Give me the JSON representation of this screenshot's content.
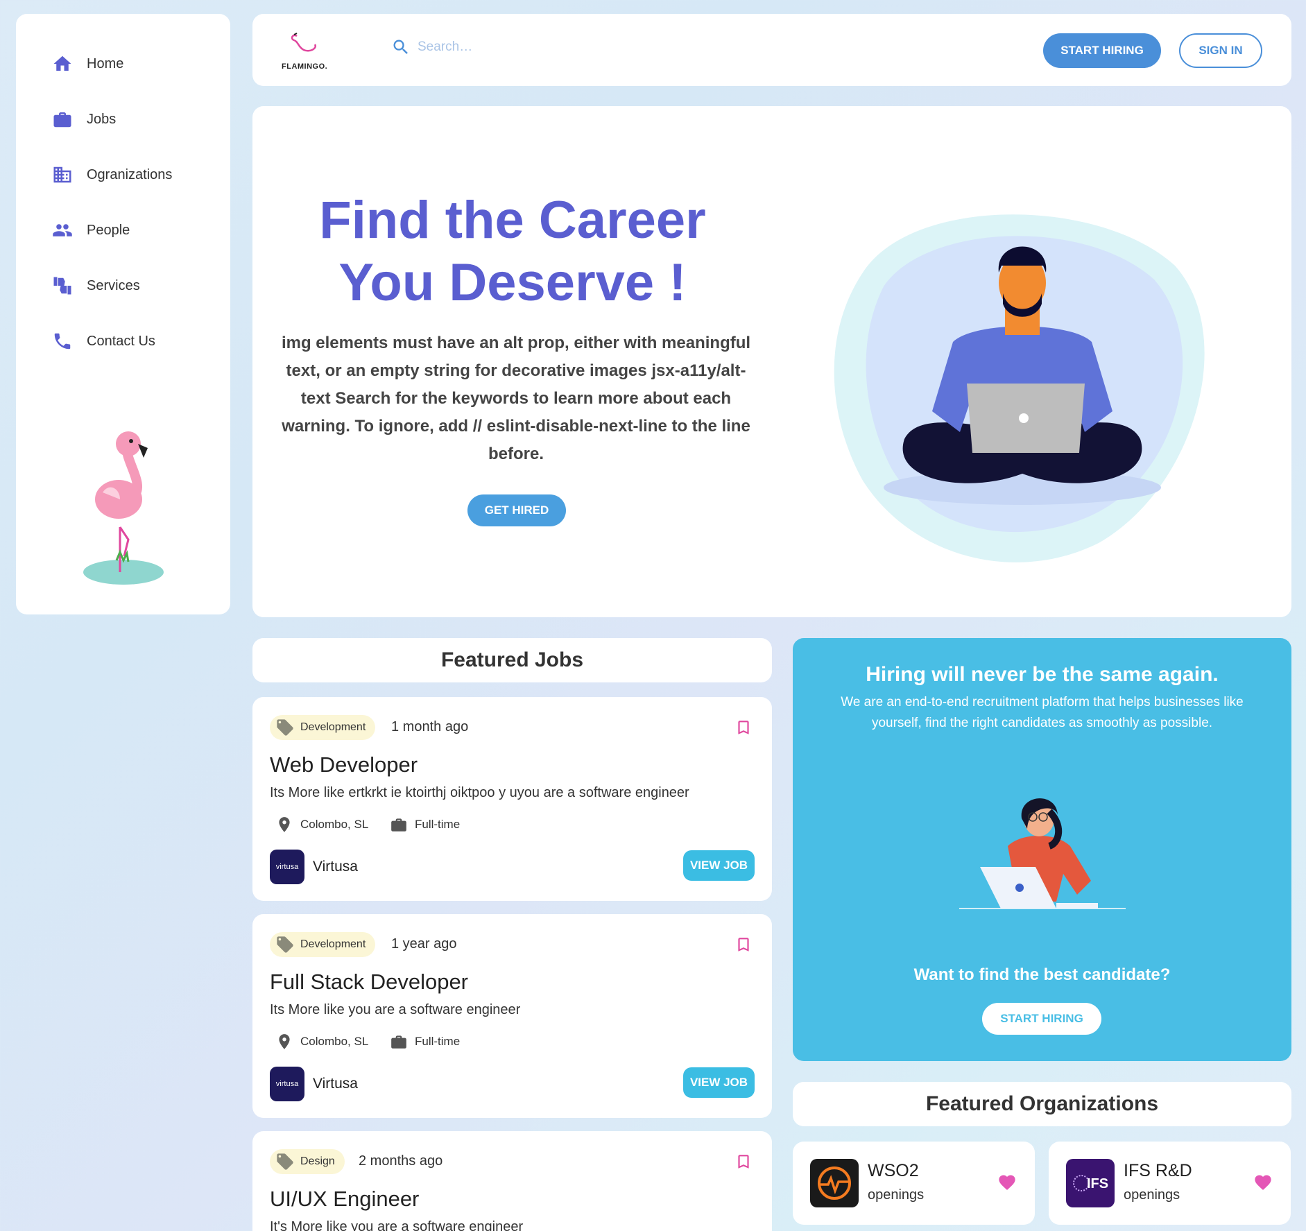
{
  "sidebar": {
    "items": [
      {
        "label": "Home",
        "icon": "home-icon"
      },
      {
        "label": "Jobs",
        "icon": "briefcase-icon"
      },
      {
        "label": "Ogranizations",
        "icon": "building-icon"
      },
      {
        "label": "People",
        "icon": "people-icon"
      },
      {
        "label": "Services",
        "icon": "thumbs-icon"
      },
      {
        "label": "Contact Us",
        "icon": "phone-icon"
      }
    ]
  },
  "header": {
    "logo_text": "FLAMINGO.",
    "search_placeholder": "Search…",
    "start_hiring": "START HIRING",
    "sign_in": "SIGN IN"
  },
  "hero": {
    "title": "Find the Career You Deserve !",
    "text": "img elements must have an alt prop, either with meaningful text, or an empty string for decorative images jsx-a11y/alt-text Search for the keywords to learn more about each warning. To ignore, add // eslint-disable-next-line to the line before.",
    "button": "GET HIRED"
  },
  "featured_jobs": {
    "heading": "Featured Jobs",
    "jobs": [
      {
        "tag": "Development",
        "time": "1 month ago",
        "title": "Web Developer",
        "desc": "Its More like ertkrkt ie ktoirthj oiktpoo y uyou are a software engineer",
        "location": "Colombo, SL",
        "type": "Full-time",
        "company": "Virtusa",
        "company_logo_text": "virtusa",
        "button": "VIEW JOB"
      },
      {
        "tag": "Development",
        "time": "1 year ago",
        "title": "Full Stack Developer",
        "desc": "Its More like you are a software engineer",
        "location": "Colombo, SL",
        "type": "Full-time",
        "company": "Virtusa",
        "company_logo_text": "virtusa",
        "button": "VIEW JOB"
      },
      {
        "tag": "Design",
        "time": "2 months ago",
        "title": "UI/UX Engineer",
        "desc": "It's More like you are a software engineer",
        "location": "",
        "type": "",
        "company": "",
        "company_logo_text": "",
        "button": ""
      }
    ]
  },
  "hiring": {
    "title": "Hiring will never be the same again.",
    "text": "We are an end-to-end recruitment platform that helps businesses like yourself, find the right candidates as smoothly as possible.",
    "question": "Want to find the best candidate?",
    "button": "START HIRING"
  },
  "featured_orgs": {
    "heading": "Featured Organizations",
    "orgs": [
      {
        "name": "WSO2",
        "sub": "openings",
        "logo_color": "#1a1a1a"
      },
      {
        "name": "IFS R&D",
        "sub": "openings",
        "logo_color": "#3a1470"
      }
    ]
  },
  "colors": {
    "primary": "#5a5ed0",
    "accent": "#4a8fd9",
    "cyan": "#49bee5",
    "pink": "#e0479e"
  }
}
